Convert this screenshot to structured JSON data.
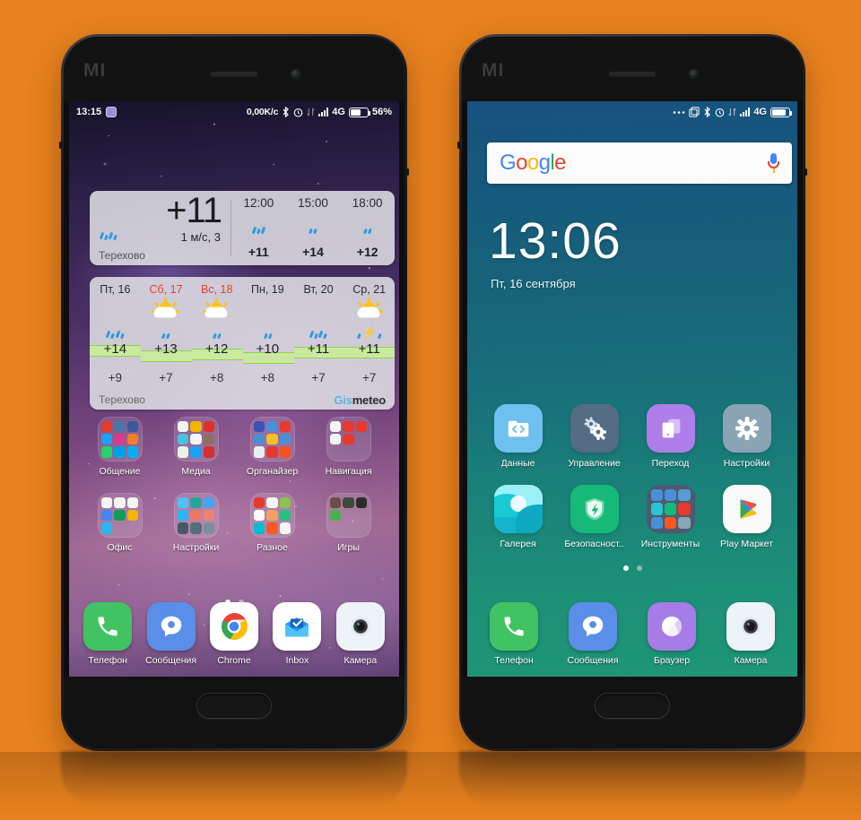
{
  "background": {
    "color": "#e8821e"
  },
  "phones": [
    {
      "name": "left-phone",
      "brand_logo": "MI",
      "wallpaper": "galaxy-purple",
      "status_bar": {
        "time": "13:15",
        "notification_icon": "message-icon",
        "net_speed": "0,00K/c",
        "icons": [
          "bluetooth-icon",
          "alarm-icon",
          "sync-icon",
          "signal-bars-icon",
          "signal-bars-icon"
        ],
        "network": "4G",
        "battery_percent": "56%"
      },
      "weather_current": {
        "temperature": "+11",
        "wind": "1 м/с, 3",
        "city": "Терехово",
        "condition_icon": "rain-icon",
        "hours": [
          {
            "time": "12:00",
            "icon": "rain-icon",
            "temp": "+11"
          },
          {
            "time": "15:00",
            "icon": "rain-icon",
            "temp": "+14"
          },
          {
            "time": "18:00",
            "icon": "rain-icon",
            "temp": "+12"
          }
        ]
      },
      "weather_forecast": {
        "city": "Терехово",
        "brand": "Gismeteo",
        "days": [
          {
            "label": "Пт, 16",
            "weekend": false,
            "sun": false,
            "precip": "rain-heavy-icon",
            "high": "+14",
            "low": "+9"
          },
          {
            "label": "Сб, 17",
            "weekend": true,
            "sun": true,
            "precip": "rain-icon",
            "high": "+13",
            "low": "+7"
          },
          {
            "label": "Вс, 18",
            "weekend": true,
            "sun": true,
            "precip": "rain-icon",
            "high": "+12",
            "low": "+8"
          },
          {
            "label": "Пн, 19",
            "weekend": false,
            "sun": false,
            "precip": "rain-icon",
            "high": "+10",
            "low": "+8"
          },
          {
            "label": "Вт, 20",
            "weekend": false,
            "sun": false,
            "precip": "rain-heavy-icon",
            "high": "+11",
            "low": "+7"
          },
          {
            "label": "Ср, 21",
            "weekend": false,
            "sun": true,
            "precip": "thunder-icon",
            "high": "+11",
            "low": "+7"
          }
        ]
      },
      "folders": [
        {
          "label": "Общение",
          "tiles": [
            "#e8392f",
            "#4a76a8",
            "#3b5998",
            "#1da1f2",
            "#d63c8c",
            "#f07f28",
            "#25d366",
            "#00a0e9",
            "#00aff0"
          ]
        },
        {
          "label": "Медиа",
          "tiles": [
            "#f5f5f5",
            "#f4b400",
            "#e52d27",
            "#48c1e0",
            "#f5f5f5",
            "#8d6e63",
            "#e9f3e7",
            "#1da1f2",
            "#d32f2f"
          ]
        },
        {
          "label": "Органайзер",
          "tiles": [
            "#3f51b5",
            "#4a90d9",
            "#e8392f",
            "#4a90d9",
            "#f6bf26",
            "#4a90d9",
            "#eceff1",
            "#e8392f",
            "#f4511e"
          ]
        },
        {
          "label": "Навигация",
          "tiles": [
            "#f5f5f5",
            "#e8392f",
            "#e8392f",
            "#f5f5f5",
            "#e8392f",
            "transparent",
            "transparent",
            "transparent",
            "transparent"
          ]
        },
        {
          "label": "Офис",
          "tiles": [
            "#f5f5f5",
            "#f5f5f5",
            "#f5f5f5",
            "#4285f4",
            "#0f9d58",
            "#f4b400",
            "#29b6f6",
            "transparent",
            "transparent"
          ]
        },
        {
          "label": "Настройки",
          "tiles": [
            "#4fc3f7",
            "#26a69a",
            "#42a5f5",
            "#29b6f6",
            "#ef7564",
            "#f0836f",
            "#455a64",
            "#546e7a",
            "#78909c"
          ]
        },
        {
          "label": "Разное",
          "tiles": [
            "#e8392f",
            "#f5f5f5",
            "#8bc34a",
            "#fdfdfd",
            "#f4a261",
            "#26c281",
            "#00bcd4",
            "#ff5722",
            "#f5f5f5"
          ]
        },
        {
          "label": "Игры",
          "tiles": [
            "#6d4c41",
            "#3e4b3a",
            "#2c2c2e",
            "#4caf50",
            "transparent",
            "transparent",
            "transparent",
            "transparent",
            "transparent"
          ]
        }
      ],
      "page_dots": {
        "count": 2,
        "active": 0
      },
      "dock": [
        {
          "label": "Телефон",
          "icon": "phone-icon",
          "color": "#41c363"
        },
        {
          "label": "Сообщения",
          "icon": "message-icon",
          "color": "#5a8ee8"
        },
        {
          "label": "Chrome",
          "icon": "chrome-icon",
          "color": "#ffffff"
        },
        {
          "label": "Inbox",
          "icon": "inbox-icon",
          "color": "#ffffff"
        },
        {
          "label": "Камера",
          "icon": "camera-icon",
          "color": "#eef3f7"
        }
      ]
    },
    {
      "name": "right-phone",
      "brand_logo": "MI",
      "wallpaper": "teal-gradient",
      "status_bar": {
        "time": "",
        "icons": [
          "dots-icon",
          "screenshot-icon",
          "bluetooth-icon",
          "alarm-icon",
          "sync-icon",
          "signal-bars-icon"
        ],
        "network": "4G",
        "battery_percent": ""
      },
      "search_widget": {
        "logo": "Google",
        "mic_icon": "microphone-icon"
      },
      "clock_widget": {
        "time": "13:06",
        "date": "Пт, 16 сентября"
      },
      "apps": [
        {
          "label": "Данные",
          "icon": "data-transfer-icon",
          "color": "#6ec0ee"
        },
        {
          "label": "Управление",
          "icon": "gears-icon",
          "color": "#546b84"
        },
        {
          "label": "Переход",
          "icon": "mi-mover-icon",
          "color": "#b07ee8"
        },
        {
          "label": "Настройки",
          "icon": "gear-icon",
          "color": "#8aa4b5"
        },
        {
          "label": "Галерея",
          "icon": "gallery-icon",
          "color": "#2bc4d4"
        },
        {
          "label": "Безопасност..",
          "icon": "shield-icon",
          "color": "#17b978"
        },
        {
          "label": "Инструменты",
          "icon": "folder-icon",
          "color": "#4a5c6d"
        },
        {
          "label": "Play Маркет",
          "icon": "play-store-icon",
          "color": "#fafafa"
        }
      ],
      "tools_folder_tiles": [
        "#4a90d9",
        "#4a90d9",
        "#5b9bd5",
        "#2bc4d4",
        "#17b978",
        "#e8392f",
        "#4a90d9",
        "#ff5722",
        "#8aa4b5"
      ],
      "page_dots": {
        "count": 2,
        "active": 0
      },
      "dock": [
        {
          "label": "Телефон",
          "icon": "phone-icon",
          "color": "#41c363"
        },
        {
          "label": "Сообщения",
          "icon": "message-icon",
          "color": "#5a8ee8"
        },
        {
          "label": "Браузер",
          "icon": "browser-icon",
          "color": "#a77ce8"
        },
        {
          "label": "Камера",
          "icon": "camera-icon",
          "color": "#eef3f7"
        }
      ]
    }
  ]
}
